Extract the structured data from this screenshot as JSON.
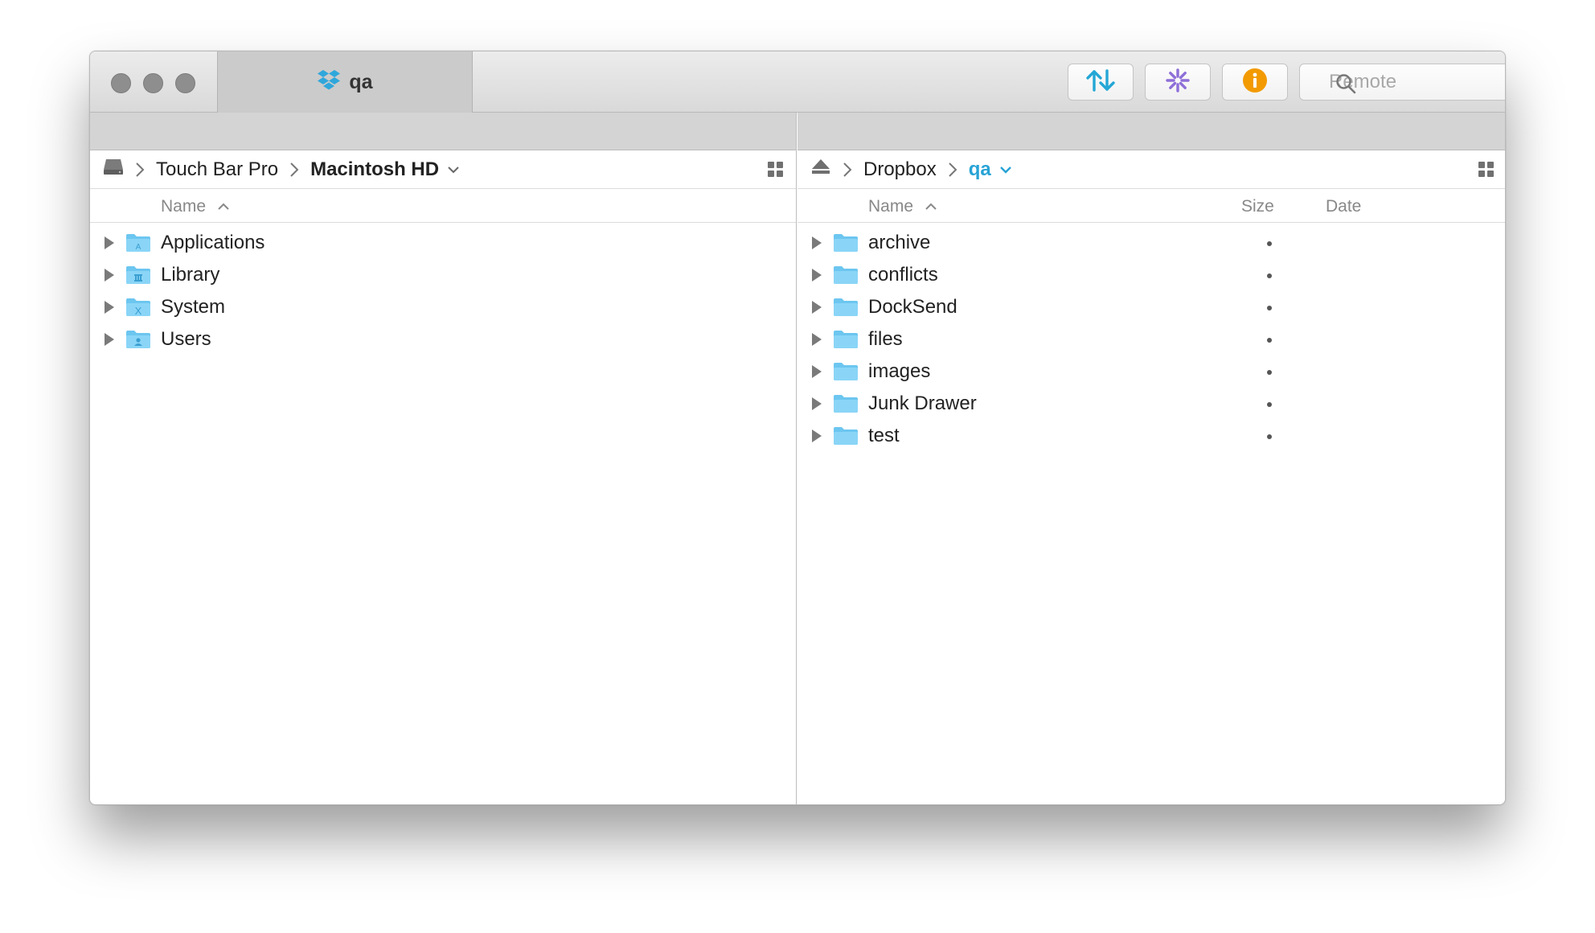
{
  "window": {
    "tab_title": "qa",
    "search_placeholder": "Remote"
  },
  "toolbar": {
    "buttons": [
      {
        "icon": "transfer-arrows-icon",
        "color": "#23a7d6"
      },
      {
        "icon": "activity-spinner-icon",
        "color": "#8e6fd8"
      },
      {
        "icon": "info-icon",
        "color": "#f29a00"
      }
    ]
  },
  "left_pane": {
    "breadcrumb": [
      "Touch Bar Pro",
      "Macintosh HD"
    ],
    "columns": {
      "name": "Name"
    },
    "items": [
      {
        "name": "Applications",
        "icon": "applications-folder-icon"
      },
      {
        "name": "Library",
        "icon": "library-folder-icon"
      },
      {
        "name": "System",
        "icon": "system-folder-icon"
      },
      {
        "name": "Users",
        "icon": "users-folder-icon"
      }
    ]
  },
  "right_pane": {
    "breadcrumb": [
      "Dropbox",
      "qa"
    ],
    "columns": {
      "name": "Name",
      "size": "Size",
      "date": "Date"
    },
    "items": [
      {
        "name": "archive",
        "size": "•"
      },
      {
        "name": "conflicts",
        "size": "•"
      },
      {
        "name": "DockSend",
        "size": "•"
      },
      {
        "name": "files",
        "size": "•"
      },
      {
        "name": "images",
        "size": "•"
      },
      {
        "name": "Junk Drawer",
        "size": "•"
      },
      {
        "name": "test",
        "size": "•"
      }
    ]
  },
  "colors": {
    "accent": "#27a3d6",
    "folder": "#6cc6f0"
  }
}
